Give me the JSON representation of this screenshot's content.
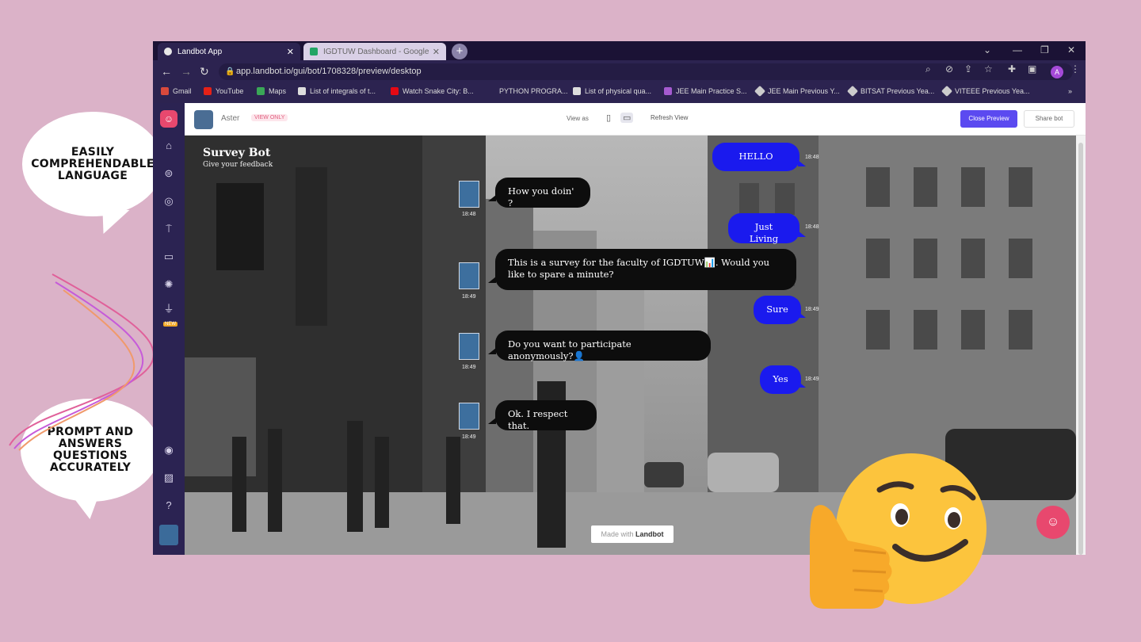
{
  "annotations": {
    "top_bubble": "EASILY COMPREHENDABLE LANGUAGE",
    "bottom_bubble": "PROMPT AND ANSWERS QUESTIONS ACCURATELY"
  },
  "browser": {
    "tabs": [
      {
        "title": "Landbot App",
        "active": true
      },
      {
        "title": "IGDTUW Dashboard - Google Shee",
        "active": false
      }
    ],
    "new_tab": "+",
    "url": "app.landbot.io/gui/bot/1708328/preview/desktop",
    "bookmarks": [
      "Gmail",
      "YouTube",
      "Maps",
      "List of integrals of t...",
      "Watch Snake City: B...",
      "PYTHON PROGRA...",
      "List of physical qua...",
      "JEE Main Practice S...",
      "JEE Main Previous Y...",
      "BITSAT Previous Yea...",
      "VITEEE Previous Yea..."
    ],
    "profile_initial": "A"
  },
  "app": {
    "bot_name": "Aster",
    "view_only": "VIEW ONLY",
    "view_as": "View as",
    "refresh_view": "Refresh View",
    "close_preview": "Close Preview",
    "share_bot": "Share bot",
    "sidebar_new": "NEW"
  },
  "chat": {
    "title": "Survey Bot",
    "subtitle": "Give your feedback",
    "messages": [
      {
        "from": "user",
        "text": "HELLO",
        "time": "18:48"
      },
      {
        "from": "bot",
        "text": "How you doin' ?",
        "time": "18:48"
      },
      {
        "from": "user",
        "text": "Just Living",
        "time": "18:48"
      },
      {
        "from": "bot",
        "text": "This is a survey for the faculty of IGDTUW📊. Would you like to spare a minute?",
        "time": "18:49"
      },
      {
        "from": "user",
        "text": "Sure",
        "time": "18:49"
      },
      {
        "from": "bot",
        "text": "Do you want to participate anonymously?👤",
        "time": "18:49"
      },
      {
        "from": "user",
        "text": "Yes",
        "time": "18:49"
      },
      {
        "from": "bot",
        "text": "Ok. I respect that.",
        "time": "18:49"
      }
    ],
    "made_with_prefix": "Made with",
    "made_with_brand": "Landbot"
  },
  "colors": {
    "background": "#dbb2c8",
    "user_bubble": "#1a1aee",
    "bot_bubble": "#0d0d0d",
    "accent": "#5b4af0",
    "brand": "#e8486e"
  }
}
